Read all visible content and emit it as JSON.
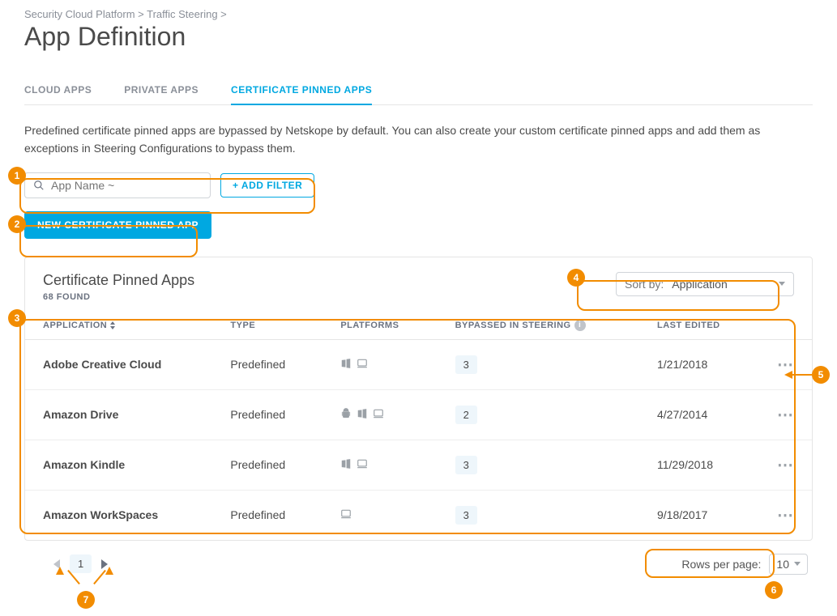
{
  "breadcrumb": "Security Cloud Platform > Traffic Steering >",
  "title": "App Definition",
  "tabs": [
    "CLOUD APPS",
    "PRIVATE APPS",
    "CERTIFICATE PINNED APPS"
  ],
  "active_tab_index": 2,
  "description": "Predefined certificate pinned apps are bypassed by Netskope by default. You can also create your custom certificate pinned apps and add them as exceptions in Steering Configurations to bypass them.",
  "search_placeholder": "App Name ~",
  "add_filter_label": "+ ADD FILTER",
  "new_app_label": "NEW CERTIFICATE PINNED APP",
  "card": {
    "title": "Certificate Pinned Apps",
    "found": "68 FOUND",
    "sort_label": "Sort by:",
    "sort_value": "Application"
  },
  "columns": {
    "app": "APPLICATION",
    "type": "TYPE",
    "platforms": "PLATFORMS",
    "bypassed": "BYPASSED IN STEERING",
    "edited": "LAST EDITED"
  },
  "rows": [
    {
      "app": "Adobe Creative Cloud",
      "type": "Predefined",
      "platforms": [
        "windows",
        "mac"
      ],
      "bypassed": "3",
      "edited": "1/21/2018"
    },
    {
      "app": "Amazon Drive",
      "type": "Predefined",
      "platforms": [
        "android",
        "windows",
        "mac"
      ],
      "bypassed": "2",
      "edited": "4/27/2014"
    },
    {
      "app": "Amazon Kindle",
      "type": "Predefined",
      "platforms": [
        "windows",
        "mac"
      ],
      "bypassed": "3",
      "edited": "11/29/2018"
    },
    {
      "app": "Amazon WorkSpaces",
      "type": "Predefined",
      "platforms": [
        "mac"
      ],
      "bypassed": "3",
      "edited": "9/18/2017"
    }
  ],
  "pager": {
    "current": "1"
  },
  "rows_per_page": {
    "label": "Rows per page:",
    "value": "10"
  },
  "annotations": [
    "1",
    "2",
    "3",
    "4",
    "5",
    "6",
    "7"
  ]
}
